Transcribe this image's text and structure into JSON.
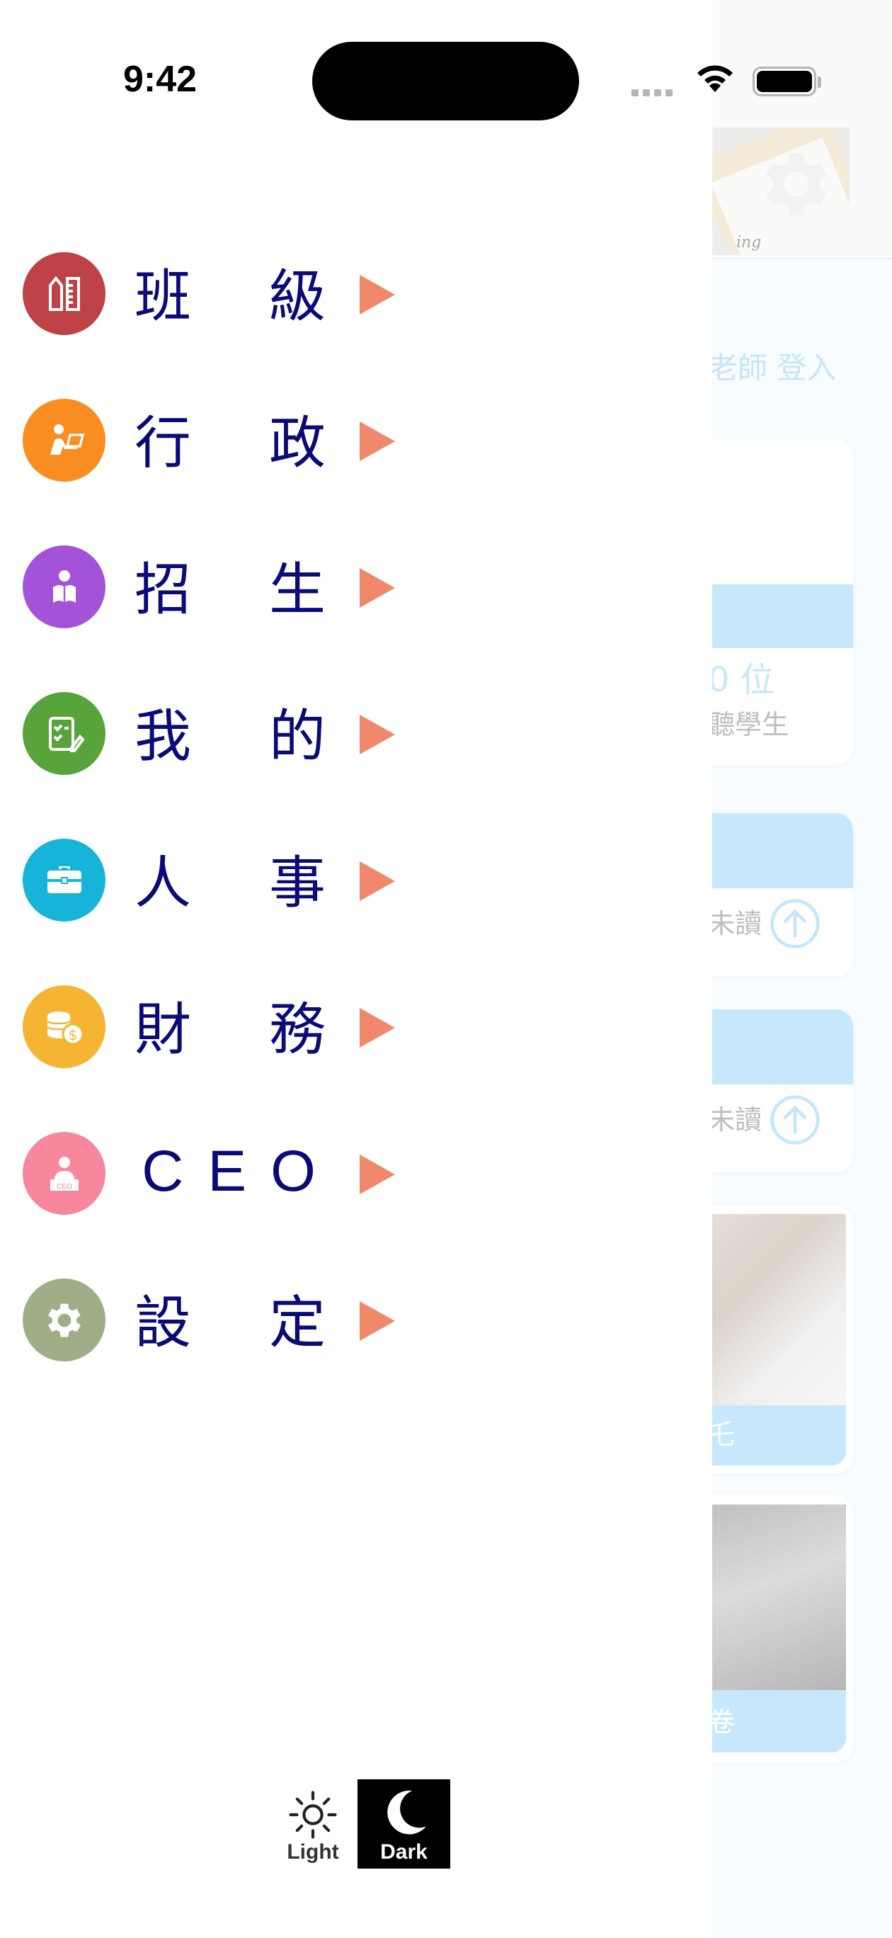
{
  "status_bar": {
    "time": "9:42"
  },
  "drawer": {
    "menu": [
      {
        "id": "class",
        "chars": [
          "班",
          "級"
        ],
        "icon": "ruler-pencil-icon",
        "color": "#bf4246"
      },
      {
        "id": "admin",
        "chars": [
          "行",
          "政"
        ],
        "icon": "teacher-desk-icon",
        "color": "#f98d22"
      },
      {
        "id": "admission",
        "chars": [
          "招",
          "生"
        ],
        "icon": "reading-student-icon",
        "color": "#a453d8"
      },
      {
        "id": "mine",
        "chars": [
          "我",
          "的"
        ],
        "icon": "checklist-pen-icon",
        "color": "#57a43a"
      },
      {
        "id": "hr",
        "chars": [
          "人",
          "事"
        ],
        "icon": "briefcase-icon",
        "color": "#15b4d8"
      },
      {
        "id": "finance",
        "chars": [
          "財",
          "務"
        ],
        "icon": "coins-icon",
        "color": "#f5b532"
      },
      {
        "id": "ceo",
        "text": "CEO",
        "icon": "ceo-person-icon",
        "color": "#f6879d"
      },
      {
        "id": "settings",
        "chars": [
          "設",
          "定"
        ],
        "icon": "gear-icon",
        "color": "#9fae86"
      }
    ],
    "arrow_color": "#f0896b",
    "label_color": "#0a0a78",
    "theme": {
      "light_label": "Light",
      "dark_label": "Dark",
      "selected": "Dark"
    }
  },
  "background_app": {
    "banner_text": "ing",
    "login_text": "老師 登入",
    "cards": [
      {
        "value": "0 位",
        "caption": "聽學生"
      },
      {
        "caption": "未讀"
      },
      {
        "caption": "未讀"
      },
      {
        "caption": "乇"
      },
      {
        "caption": "卷"
      }
    ]
  }
}
